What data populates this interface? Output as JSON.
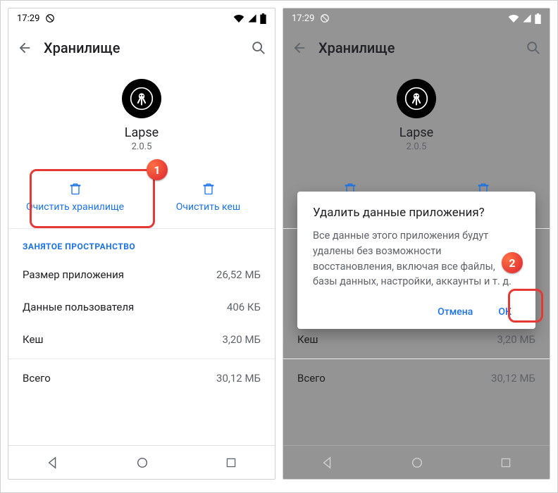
{
  "status": {
    "time": "17:29"
  },
  "appbar": {
    "title": "Хранилище"
  },
  "app": {
    "name": "Lapse",
    "version": "2.0.5"
  },
  "actions": {
    "clear_storage": "Очистить хранилище",
    "clear_cache": "Очистить кеш"
  },
  "section": {
    "header": "ЗАНЯТОЕ ПРОСТРАНСТВО"
  },
  "rows": {
    "app_size_label": "Размер приложения",
    "app_size_value": "26,52 МБ",
    "user_data_label": "Данные пользователя",
    "user_data_value": "406 КБ",
    "cache_label": "Кеш",
    "cache_value": "3,20 МБ",
    "total_label": "Всего",
    "total_value": "30,12 МБ"
  },
  "dialog": {
    "title": "Удалить данные приложения?",
    "body": "Все данные этого приложения будут удалены без возможности восстановления, включая все файлы, базы данных, настройки, аккаунты и т. д.",
    "cancel": "Отмена",
    "ok": "ОК"
  },
  "callouts": {
    "one": "1",
    "two": "2"
  }
}
